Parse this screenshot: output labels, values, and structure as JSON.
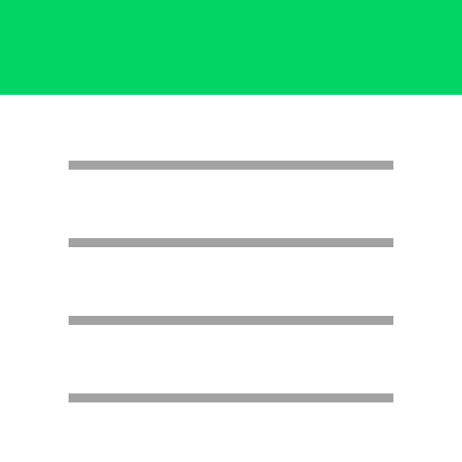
{
  "colors": {
    "header": "#00d566",
    "background": "#ffffff",
    "line": "#a2a2a2"
  },
  "icon": {
    "name": "notes-list-icon",
    "line_count": 4
  }
}
